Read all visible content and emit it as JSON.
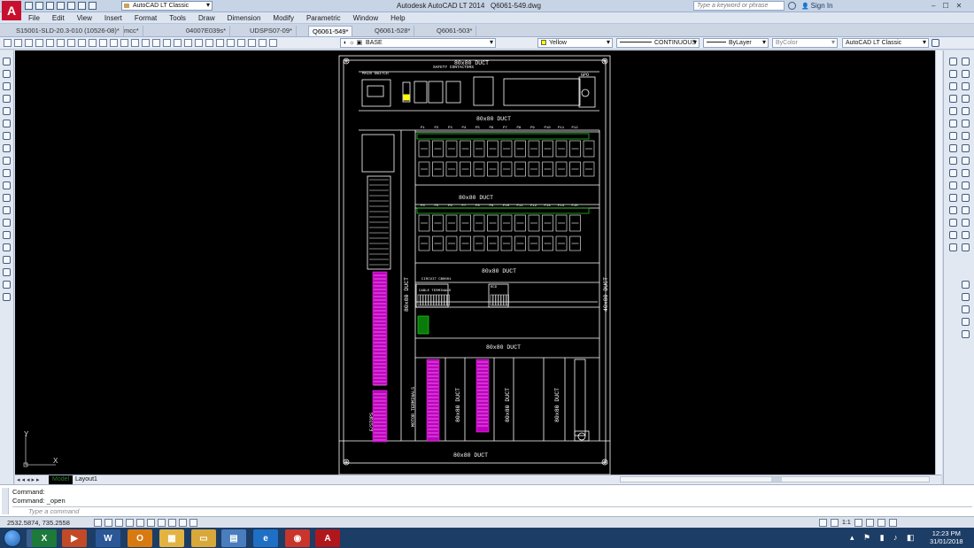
{
  "window": {
    "title": "Autodesk AutoCAD LT 2014",
    "file": "Q6061-549.dwg",
    "workspace": "AutoCAD LT Classic",
    "search_placeholder": "Type a keyword or phrase",
    "signin": "Sign In",
    "controls": [
      "–",
      "☐",
      "✕"
    ]
  },
  "menu": [
    "File",
    "Edit",
    "View",
    "Insert",
    "Format",
    "Tools",
    "Draw",
    "Dimension",
    "Modify",
    "Parametric",
    "Window",
    "Help"
  ],
  "doc_tabs": [
    "S15001-SLD-20.3-010 (10526-08)*",
    "mcc*",
    "04007E039s*",
    "UDSPS07-09*",
    "Q6061-549*",
    "Q6061-528*",
    "Q6061-503*"
  ],
  "active_doc_tab": 4,
  "properties": {
    "layer": "BASE",
    "color": "Yellow",
    "linetype": "CONTINUOUS",
    "lineweight": "ByLayer",
    "plotstyle": "ByColor",
    "workspace2": "AutoCAD LT Classic"
  },
  "drawing": {
    "ducts": [
      "80x80 DUCT",
      "80x80 DUCT",
      "80x80 DUCT",
      "80x80 DUCT",
      "80x80 DUCT",
      "80x80 DUCT"
    ],
    "vertical_ducts": [
      "80x80 DUCT",
      "40x80 DUCT",
      "80x80 DUCT",
      "80x80 DUCT",
      "80x80 DUCT"
    ],
    "labels": {
      "main_switch": "MAIN SWITCH",
      "safety_contactors": "SAFETY CONTACTORS",
      "gpo": "GPO",
      "motor_terminals": "MOTOR TERMINALS",
      "estops": "E/STOPS",
      "rcd": "RCD",
      "circuit_breakers": "CIRCUIT CB0001",
      "cable_terminals": "CABLE TERMINALS"
    },
    "header_row_1": [
      "P1",
      "P2",
      "P3",
      "P4",
      "P5",
      "P6",
      "P7",
      "P8",
      "P9",
      "P10",
      "P11",
      "P12"
    ],
    "header_row_2": [
      "P6",
      "P5",
      "P6",
      "P7",
      "P8",
      "P9",
      "P10",
      "P11",
      "P12",
      "P13",
      "P14",
      "P15"
    ]
  },
  "layout_tabs": [
    "Model",
    "Layout1"
  ],
  "command": {
    "history": [
      "Command:",
      "Command:  _open"
    ],
    "prompt": "Type a command"
  },
  "status": {
    "coords": "2532.5874, 735.2558",
    "annotation_scale": "1:1"
  },
  "taskbar": {
    "apps": [
      "Explorer",
      "Excel",
      "PowerPoint",
      "Word",
      "Outlook",
      "Files",
      "Folder",
      "Notes",
      "Internet Explorer",
      "Chrome",
      "AutoCAD"
    ],
    "time": "12:23 PM",
    "date": "31/01/2018"
  }
}
